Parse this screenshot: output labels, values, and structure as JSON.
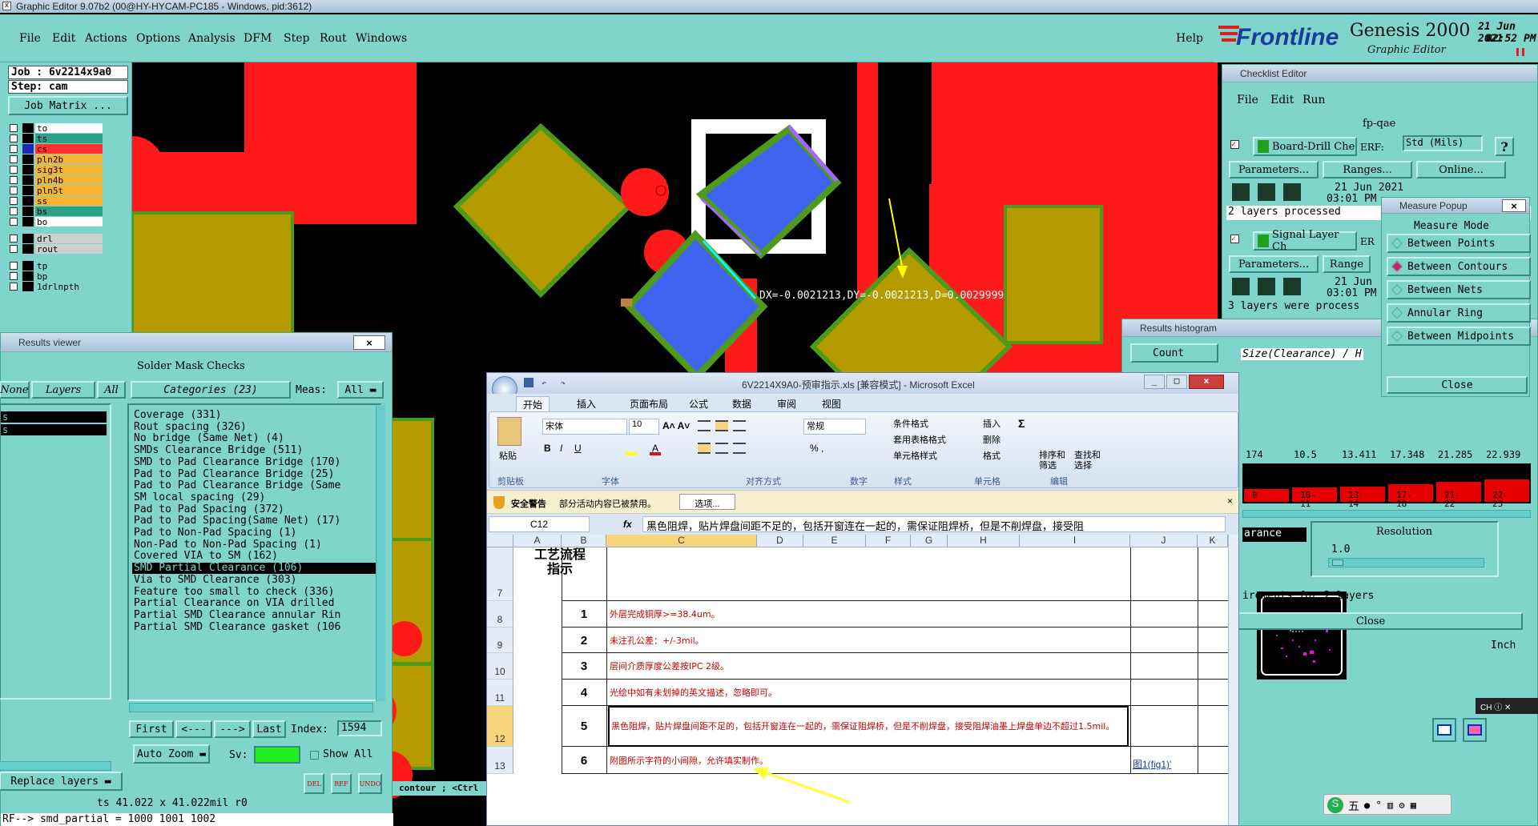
{
  "app": {
    "title": "Graphic Editor 9.07b2 (00@HY-HYCAM-PC185 - Windows, pid:3612)"
  },
  "menu": {
    "file": "File",
    "edit": "Edit",
    "actions": "Actions",
    "options": "Options",
    "analysis": "Analysis",
    "dfm": "DFM",
    "step": "Step",
    "rout": "Rout",
    "windows": "Windows",
    "help": "Help"
  },
  "brand": {
    "logo": "Frontline",
    "product": "Genesis 2000",
    "subtitle": "Graphic Editor",
    "date": "21 Jun 2021",
    "time": "02:52 PM"
  },
  "job": {
    "job_label": "Job : 6v2214x9a0",
    "step_label": "Step: cam",
    "matrix_button": "Job Matrix ..."
  },
  "layers": [
    {
      "name": "to",
      "color": "#ffffff",
      "active": false
    },
    {
      "name": "ts",
      "color": "#2ea089",
      "active": false
    },
    {
      "name": "cs",
      "color": "#ff3030",
      "active": true
    },
    {
      "name": "pln2b",
      "color": "#f5b531",
      "active": false
    },
    {
      "name": "sig3t",
      "color": "#f5b531",
      "active": false
    },
    {
      "name": "pln4b",
      "color": "#f5b531",
      "active": false
    },
    {
      "name": "pln5t",
      "color": "#f5b531",
      "active": false
    },
    {
      "name": "ss",
      "color": "#f5b531",
      "active": false
    },
    {
      "name": "bs",
      "color": "#2ea089",
      "active": false
    },
    {
      "name": "bo",
      "color": "#ffffff",
      "active": false
    },
    {
      "name": "drl",
      "color": "#cfcfcf",
      "active": false
    },
    {
      "name": "rout",
      "color": "#cfcfcf",
      "active": false
    },
    {
      "name": "tp",
      "color": "#7fd4cc",
      "active": false
    },
    {
      "name": "bp",
      "color": "#7fd4cc",
      "active": false
    },
    {
      "name": "1drlnpth",
      "color": "#7fd4cc",
      "active": false
    }
  ],
  "canvas": {
    "measure_readout": "DX=-0.0021213,DY=-0.0021213,D=0.0029999"
  },
  "results_viewer": {
    "title": "Results viewer",
    "heading": "Solder Mask Checks",
    "none": "None",
    "layers": "Layers",
    "all": "All",
    "categories_label": "Categories (23)",
    "meas_label": "Meas:",
    "meas_value": "All",
    "left_list": [
      "s",
      "s"
    ],
    "categories": [
      "Coverage (331)",
      "Rout spacing (326)",
      "No bridge (Same Net) (4)",
      "SMDs Clearance Bridge (511)",
      "SMD to Pad Clearance Bridge (170)",
      "Pad to Pad Clearance Bridge (25)",
      "Pad to Pad Clearance Bridge (Same",
      "SM local spacing (29)",
      "Pad to Pad Spacing (372)",
      "Pad to Pad Spacing(Same Net) (17)",
      "Pad to Non-Pad Spacing (1)",
      "Non-Pad to Non-Pad Spacing (1)",
      "Covered VIA to SM (162)",
      "SMD Partial Clearance (106)",
      "Via to SMD Clearance (303)",
      "Feature too small to check (336)",
      "Partial Clearance on VIA drilled",
      "Partial SMD Clearance annular Rin",
      "Partial SMD Clearance gasket (106"
    ],
    "selected_index": 13,
    "first": "First",
    "prev": "<---",
    "next": "--->",
    "last": "Last",
    "index_label": "Index:",
    "index_value": "1594",
    "auto_zoom": "Auto Zoom",
    "sv_label": "Sv:",
    "show_all": "Show All",
    "replace_layers": "Replace layers",
    "status_size": "ts 41.022 x 41.022mil  r0",
    "status_ref": "RF--> smd_partial = 1000 1001 1002",
    "del": "DEL",
    "ref": "REF",
    "undo": "UNDO"
  },
  "cmd_hint": "contour ; <Ctrl",
  "checklist": {
    "title": "Checklist Editor",
    "file": "File",
    "edit": "Edit",
    "run": "Run",
    "name": "fp-qae",
    "rows": [
      {
        "name": "Board-Drill Che",
        "tag": "ERF:",
        "erf": "Std (Mils)",
        "q": "?",
        "params": "Parameters...",
        "ranges": "Ranges...",
        "online": "Online...",
        "date": "21 Jun 2021",
        "time": "03:01 PM",
        "status": "2 layers processed"
      },
      {
        "name": "Signal Layer Ch",
        "tag": "ER",
        "params": "Parameters...",
        "ranges": "Range",
        "date": "21 Jun",
        "time": "03:01 PM",
        "status": "3 layers were process"
      }
    ]
  },
  "measure_popup": {
    "title": "Measure Popup",
    "mode": "Measure Mode",
    "items": [
      "Between Points",
      "Between Contours",
      "Between Nets",
      "Annular Ring",
      "Between Midpoints"
    ],
    "active_index": 1,
    "close": "Close"
  },
  "histogram": {
    "title": "Results histogram",
    "count": "Count",
    "size_label": "Size(Clearance) / H",
    "values": [
      "174",
      "10.5",
      "13.411",
      "17.348",
      "21.285",
      "22.939"
    ],
    "bins": [
      "0",
      "10-\n11",
      "13-\n14",
      "17-\n18",
      "21-\n22",
      "22-\n23"
    ],
    "heights": [
      0.15,
      0.28,
      0.35,
      0.55,
      0.78,
      1.0
    ],
    "arance": "arance",
    "resolution_label": "Resolution",
    "resolution_value": "1.0",
    "requirements": "irements for 2 layers",
    "close": "Close",
    "unit": "Inch"
  },
  "excel": {
    "title": "6V2214X9A0-预审指示.xls [兼容模式] - Microsoft Excel",
    "tabs": [
      "开始",
      "插入",
      "页面布局",
      "公式",
      "数据",
      "审阅",
      "视图"
    ],
    "font_name": "宋体",
    "font_size": "10",
    "number_format": "常规",
    "group_labels": [
      "剪贴板",
      "字体",
      "对齐方式",
      "数字",
      "样式",
      "单元格",
      "编辑"
    ],
    "paste": "粘贴",
    "style_items": [
      "条件格式",
      "套用表格格式",
      "单元格样式"
    ],
    "cell_items": [
      "插入",
      "删除",
      "格式"
    ],
    "edit_items": [
      "排序和筛选",
      "查找和选择"
    ],
    "security_label": "安全警告",
    "security_msg": "部分活动内容已被禁用。",
    "options_btn": "选项...",
    "name_box": "C12",
    "fx": "fx",
    "formula": "黑色阻焊，贴片焊盘间距不足的，包括开窗连在一起的，需保证阻焊桥，但是不削焊盘，接受阻",
    "columns": [
      "A",
      "B",
      "C",
      "D",
      "E",
      "F",
      "G",
      "H",
      "I",
      "J",
      "K"
    ],
    "header_cell": "工艺流程\n指示",
    "rows": [
      {
        "row": "7",
        "num": "",
        "text": ""
      },
      {
        "row": "8",
        "num": "1",
        "text": "外层完成铜厚>=38.4um。"
      },
      {
        "row": "9",
        "num": "2",
        "text": "未注孔公差：+/-3mil。"
      },
      {
        "row": "10",
        "num": "3",
        "text": "层间介质厚度公差按IPC 2级。"
      },
      {
        "row": "11",
        "num": "4",
        "text": "光绘中如有未划掉的英文描述，忽略即可。"
      },
      {
        "row": "12",
        "num": "5",
        "text": "黑色阻焊，贴片焊盘间距不足的，包括开窗连在一起的，需保证阻焊桥，但是不削焊盘，接受阻焊油墨上焊盘单边不超过1.5mil。"
      },
      {
        "row": "13",
        "num": "6",
        "text": "附图所示字符的小间隙，允许填实制作。"
      }
    ],
    "link_cell": "图1(fig1)'"
  },
  "ime": {
    "ch": "CH",
    "items": "五"
  }
}
